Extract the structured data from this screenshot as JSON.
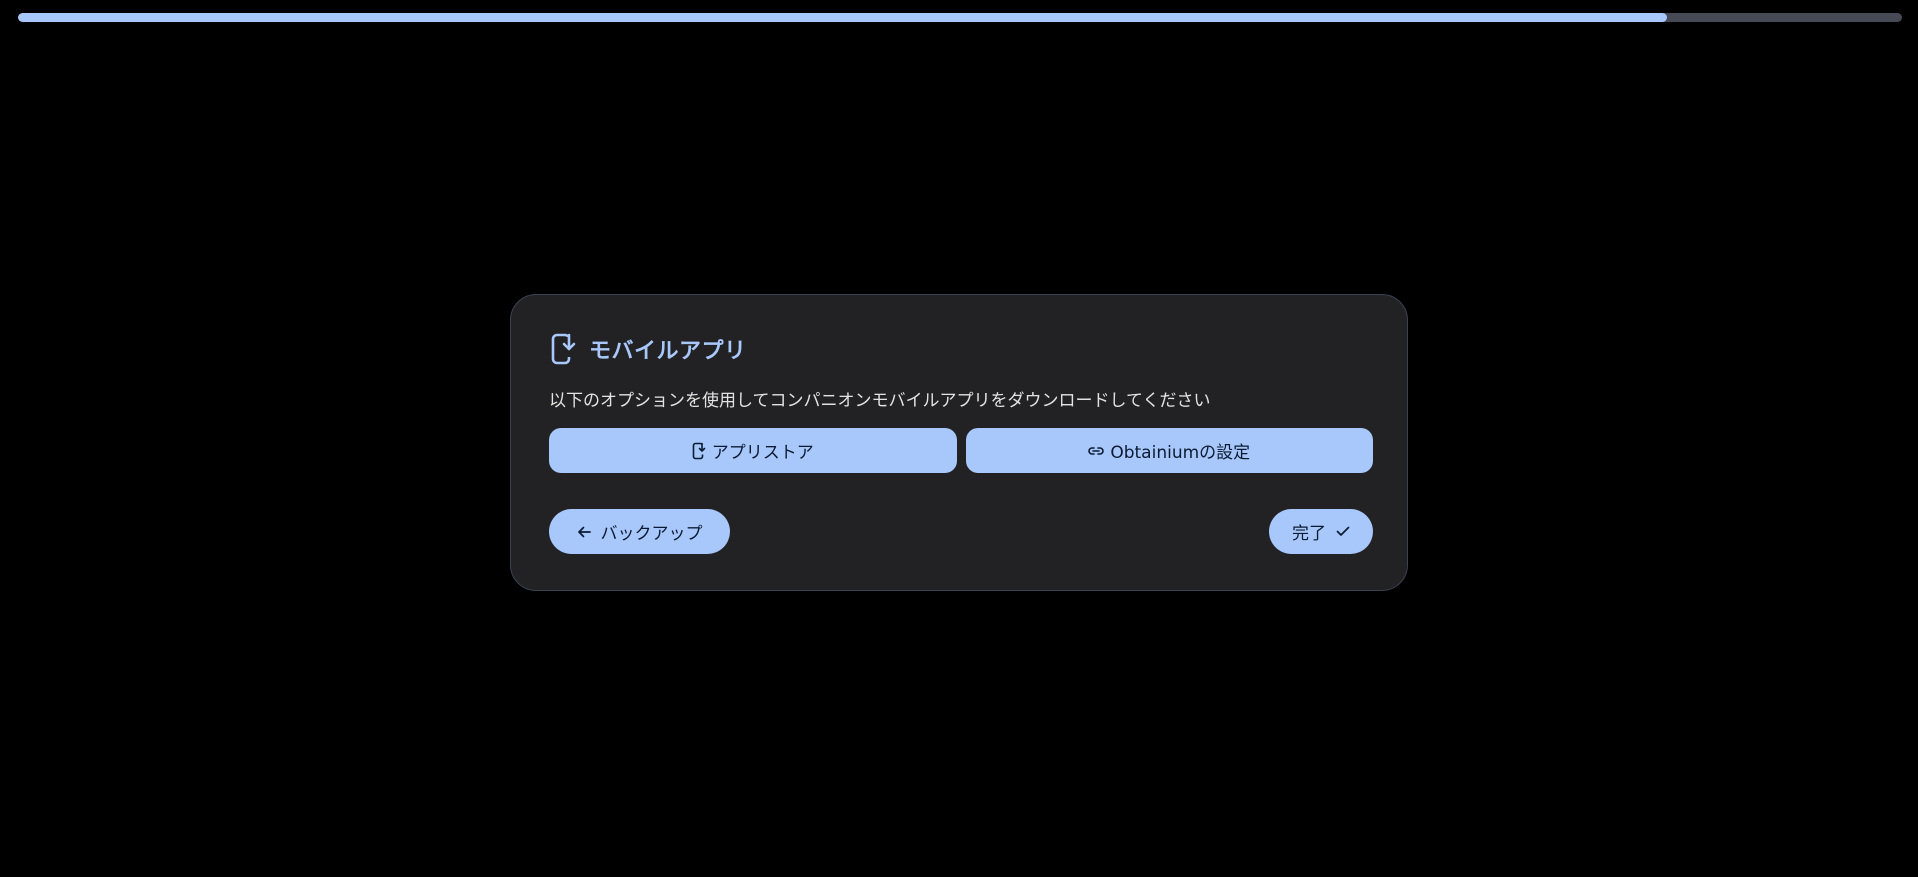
{
  "progress": {
    "fraction": 0.875,
    "fill_color": "#a8c7fa",
    "track_color": "#454a55"
  },
  "dialog": {
    "icon": "mobile-download-icon",
    "title": "モバイルアプリ",
    "description": "以下のオプションを使用してコンパニオンモバイルアプリをダウンロードしてください",
    "options": [
      {
        "icon": "mobile-download-icon",
        "label": "アプリストア"
      },
      {
        "icon": "link-icon",
        "label": "Obtainiumの設定"
      }
    ],
    "back_button": {
      "icon": "arrow-left-icon",
      "label": "バックアップ"
    },
    "done_button": {
      "icon": "check-icon",
      "label": "完了"
    }
  },
  "colors": {
    "accent": "#a8c7fa",
    "background": "#000000",
    "card": "#222224"
  }
}
